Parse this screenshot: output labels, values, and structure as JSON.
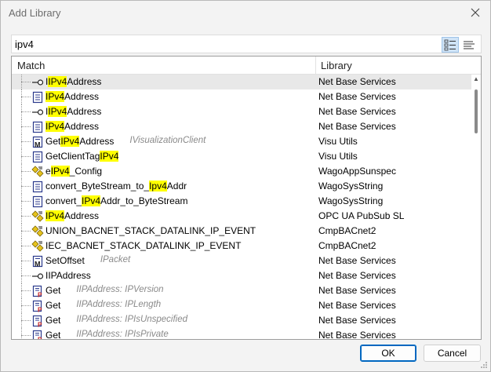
{
  "window": {
    "title": "Add Library"
  },
  "search": {
    "value": "ipv4"
  },
  "columns": {
    "match": "Match",
    "library": "Library"
  },
  "rows": [
    {
      "icon": "interface-icon",
      "pre": "I",
      "hl": "IPv4",
      "post": "Address",
      "ctx": "",
      "lib": "Net Base Services",
      "selected": true
    },
    {
      "icon": "document-icon",
      "pre": "",
      "hl": "IPv4",
      "post": "Address",
      "ctx": "",
      "lib": "Net Base Services"
    },
    {
      "icon": "interface-icon",
      "pre": "I",
      "hl": "IPv4",
      "post": "Address",
      "ctx": "",
      "lib": "Net Base Services"
    },
    {
      "icon": "document-icon",
      "pre": "",
      "hl": "IPv4",
      "post": "Address",
      "ctx": "",
      "lib": "Net Base Services"
    },
    {
      "icon": "method-icon",
      "pre": "Get",
      "hl": "IPv4",
      "post": "Address",
      "ctx": "IVisualizationClient",
      "lib": "Visu Utils"
    },
    {
      "icon": "document-icon",
      "pre": "GetClientTag",
      "hl": "IPv4",
      "post": "",
      "ctx": "",
      "lib": "Visu Utils"
    },
    {
      "icon": "enum-icon",
      "pre": "e",
      "hl": "IPv4",
      "post": "_Config",
      "ctx": "",
      "lib": "WagoAppSunspec"
    },
    {
      "icon": "document-icon",
      "pre": "convert_ByteStream_to_",
      "hl": "Ipv4",
      "post": "Addr",
      "ctx": "",
      "lib": "WagoSysString"
    },
    {
      "icon": "document-icon",
      "pre": "convert_",
      "hl": "IPv4",
      "post": "Addr_to_ByteStream",
      "ctx": "",
      "lib": "WagoSysString"
    },
    {
      "icon": "enum-icon",
      "pre": "",
      "hl": "IPv4",
      "post": "Address",
      "ctx": "",
      "lib": "OPC UA PubSub SL"
    },
    {
      "icon": "enum-icon",
      "pre": "UNION_BACNET_STACK_DATALINK_IP_EVENT",
      "hl": "",
      "post": "",
      "ctx": "",
      "lib": "CmpBACnet2"
    },
    {
      "icon": "enum-icon",
      "pre": "IEC_BACNET_STACK_DATALINK_IP_EVENT",
      "hl": "",
      "post": "",
      "ctx": "",
      "lib": "CmpBACnet2"
    },
    {
      "icon": "method-icon",
      "pre": "SetOffset",
      "hl": "",
      "post": "",
      "ctx": "IPacket",
      "lib": "Net Base Services"
    },
    {
      "icon": "interface-icon",
      "pre": "IIPAddress",
      "hl": "",
      "post": "",
      "ctx": "",
      "lib": "Net Base Services"
    },
    {
      "icon": "property-icon",
      "pre": "Get",
      "hl": "",
      "post": "",
      "ctx": "IIPAddress: IPVersion",
      "lib": "Net Base Services"
    },
    {
      "icon": "property-icon",
      "pre": "Get",
      "hl": "",
      "post": "",
      "ctx": "IIPAddress: IPLength",
      "lib": "Net Base Services"
    },
    {
      "icon": "property-icon",
      "pre": "Get",
      "hl": "",
      "post": "",
      "ctx": "IIPAddress: IPIsUnspecified",
      "lib": "Net Base Services"
    },
    {
      "icon": "property-icon",
      "pre": "Get",
      "hl": "",
      "post": "",
      "ctx": "IIPAddress: IPIsPrivate",
      "lib": "Net Base Services"
    }
  ],
  "buttons": {
    "ok": "OK",
    "cancel": "Cancel"
  },
  "colors": {
    "highlight": "#ffff00",
    "selected_row": "#e8e8e8",
    "ok_border": "#0067c0"
  }
}
